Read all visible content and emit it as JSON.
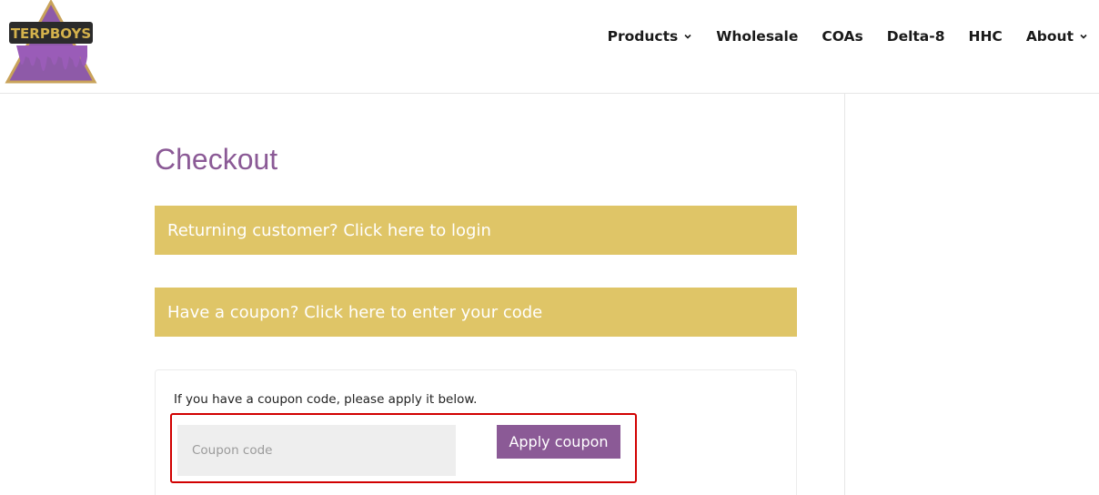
{
  "header": {
    "logo_alt": "TERPBOYS",
    "nav": [
      {
        "label": "Products",
        "has_dropdown": true
      },
      {
        "label": "Wholesale",
        "has_dropdown": false
      },
      {
        "label": "COAs",
        "has_dropdown": false
      },
      {
        "label": "Delta-8",
        "has_dropdown": false
      },
      {
        "label": "HHC",
        "has_dropdown": false
      },
      {
        "label": "About",
        "has_dropdown": true
      }
    ]
  },
  "main": {
    "title": "Checkout",
    "returning_notice": "Returning customer? Click here to login",
    "coupon_notice": "Have a coupon? Click here to enter your code",
    "coupon_form": {
      "instructions": "If you have a coupon code, please apply it below.",
      "input_placeholder": "Coupon code",
      "input_value": "",
      "apply_label": "Apply coupon"
    }
  },
  "colors": {
    "accent_purple": "#8b5a96",
    "notice_gold": "#dfc567",
    "highlight_red": "#d10000"
  },
  "icons": {
    "dropdown": "chevron-down-icon",
    "logo": "terpboys-logo"
  }
}
